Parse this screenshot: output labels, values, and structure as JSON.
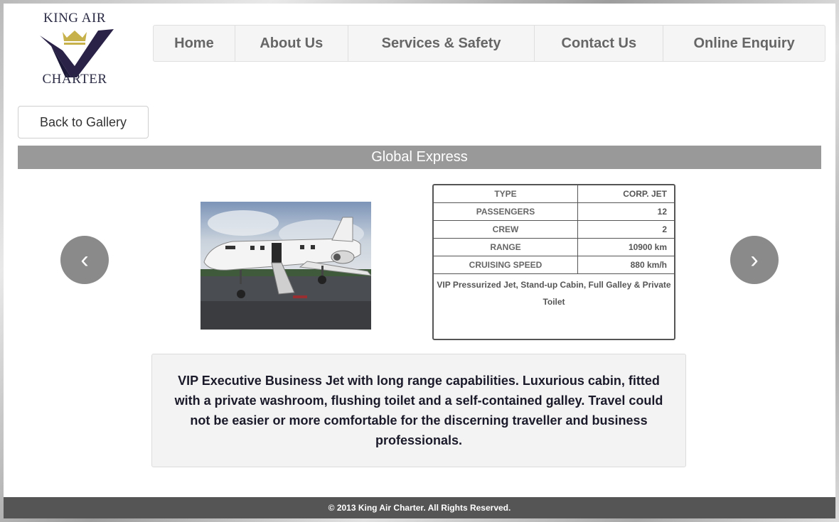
{
  "brand": {
    "line1": "KING AIR",
    "line2": "CHARTER",
    "colors": {
      "navy": "#2b2248",
      "gold": "#c7b14a"
    }
  },
  "nav": [
    {
      "label": "Home"
    },
    {
      "label": "About Us"
    },
    {
      "label": "Services & Safety"
    },
    {
      "label": "Contact Us"
    },
    {
      "label": "Online Enquiry"
    }
  ],
  "back_label": "Back to Gallery",
  "aircraft": {
    "name": "Global Express",
    "specs": [
      {
        "key": "TYPE",
        "value": "CORP. JET"
      },
      {
        "key": "PASSENGERS",
        "value": "12"
      },
      {
        "key": "CREW",
        "value": "2"
      },
      {
        "key": "RANGE",
        "value": "10900 km"
      },
      {
        "key": "CRUISING SPEED",
        "value": "880 km/h"
      }
    ],
    "note": "VIP Pressurized Jet, Stand-up Cabin, Full Galley & Private Toilet",
    "description": "VIP Executive Business Jet with long range capabilities. Luxurious cabin, fitted with a private washroom, flushing toilet and a self-contained galley. Travel could not be easier or more comfortable for the discerning traveller and business professionals."
  },
  "carousel": {
    "prev_icon": "‹",
    "next_icon": "›"
  },
  "footer": "© 2013 King Air Charter. All Rights Reserved."
}
